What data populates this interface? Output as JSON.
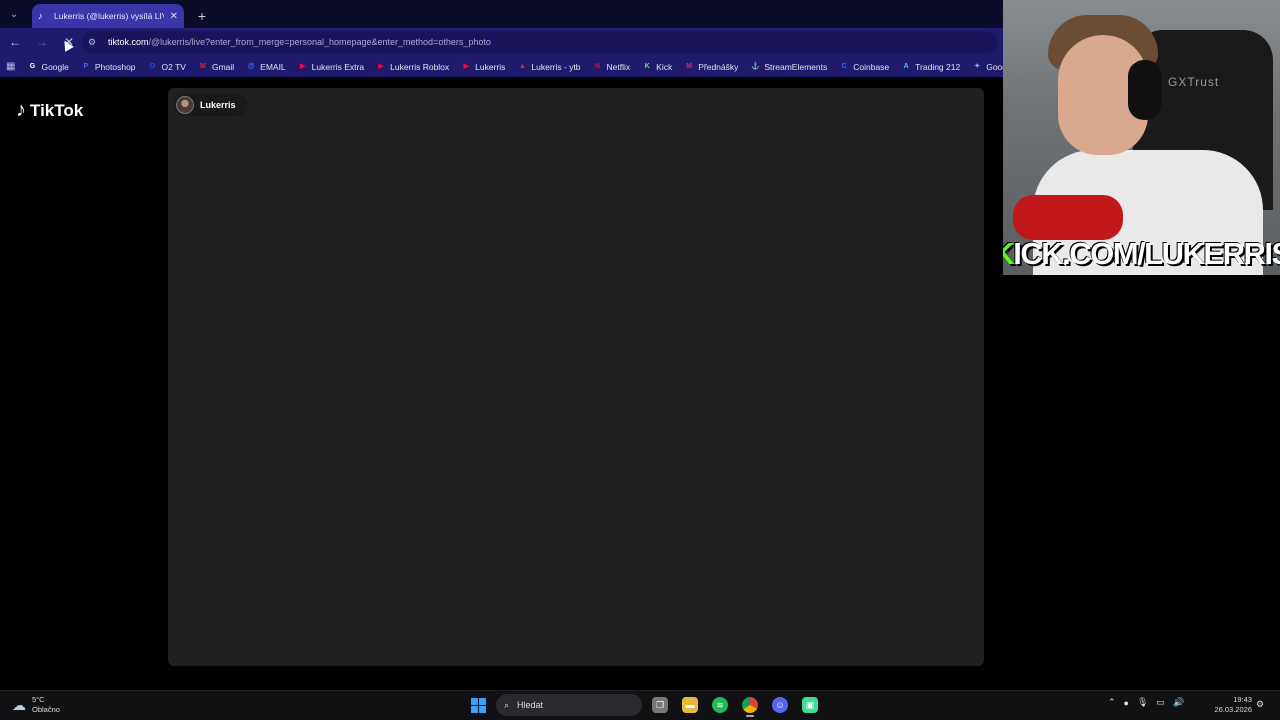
{
  "browser": {
    "tab": {
      "title": "Lukerris (@lukerris) vysílá LIVE",
      "close": "✕"
    },
    "new_tab": "+",
    "nav": {
      "back": "←",
      "forward": "→",
      "reload": "✕"
    },
    "url": {
      "host": "tiktok.com",
      "path": "/@lukerris/live?enter_from_merge=personal_homepage&enter_method=others_photo"
    },
    "bookmarks": [
      {
        "label": "Google",
        "icon": "G",
        "color": "#ffffff"
      },
      {
        "label": "Photoshop",
        "icon": "P",
        "color": "#2f6cff"
      },
      {
        "label": "O2 TV",
        "icon": "O",
        "color": "#1d4fd8"
      },
      {
        "label": "Gmail",
        "icon": "M",
        "color": "#d93025"
      },
      {
        "label": "EMAIL",
        "icon": "@",
        "color": "#3b6fff"
      },
      {
        "label": "Lukerris Extra",
        "icon": "▶",
        "color": "#ff0033"
      },
      {
        "label": "Lukerris Roblox",
        "icon": "▶",
        "color": "#ff0033"
      },
      {
        "label": "Lukerris",
        "icon": "▶",
        "color": "#ff0033"
      },
      {
        "label": "Lukerris - ytb",
        "icon": "▲",
        "color": "#c0392b"
      },
      {
        "label": "Netflix",
        "icon": "N",
        "color": "#e50914"
      },
      {
        "label": "Kick",
        "icon": "K",
        "color": "#53fc18"
      },
      {
        "label": "Přednášky",
        "icon": "M",
        "color": "#e91e63"
      },
      {
        "label": "StreamElements",
        "icon": "⚓",
        "color": "#cccccc"
      },
      {
        "label": "Coinbase",
        "icon": "C",
        "color": "#2f6cff"
      },
      {
        "label": "Trading 212",
        "icon": "A",
        "color": "#4fc3f7"
      },
      {
        "label": "Google Gem",
        "icon": "✦",
        "color": "#8ab4f8"
      }
    ]
  },
  "page": {
    "logo": "TikTok",
    "host_name": "Lukerris"
  },
  "overlay": {
    "chair_brand": "GXTrust",
    "kick_prefix": "K",
    "kick_rest": "ICK.COM/LUKERRIS"
  },
  "taskbar": {
    "weather_temp": "5°C",
    "weather_desc": "Oblačno",
    "search_label": "Hledat",
    "time": "19:43",
    "date": "26.03.2026"
  }
}
